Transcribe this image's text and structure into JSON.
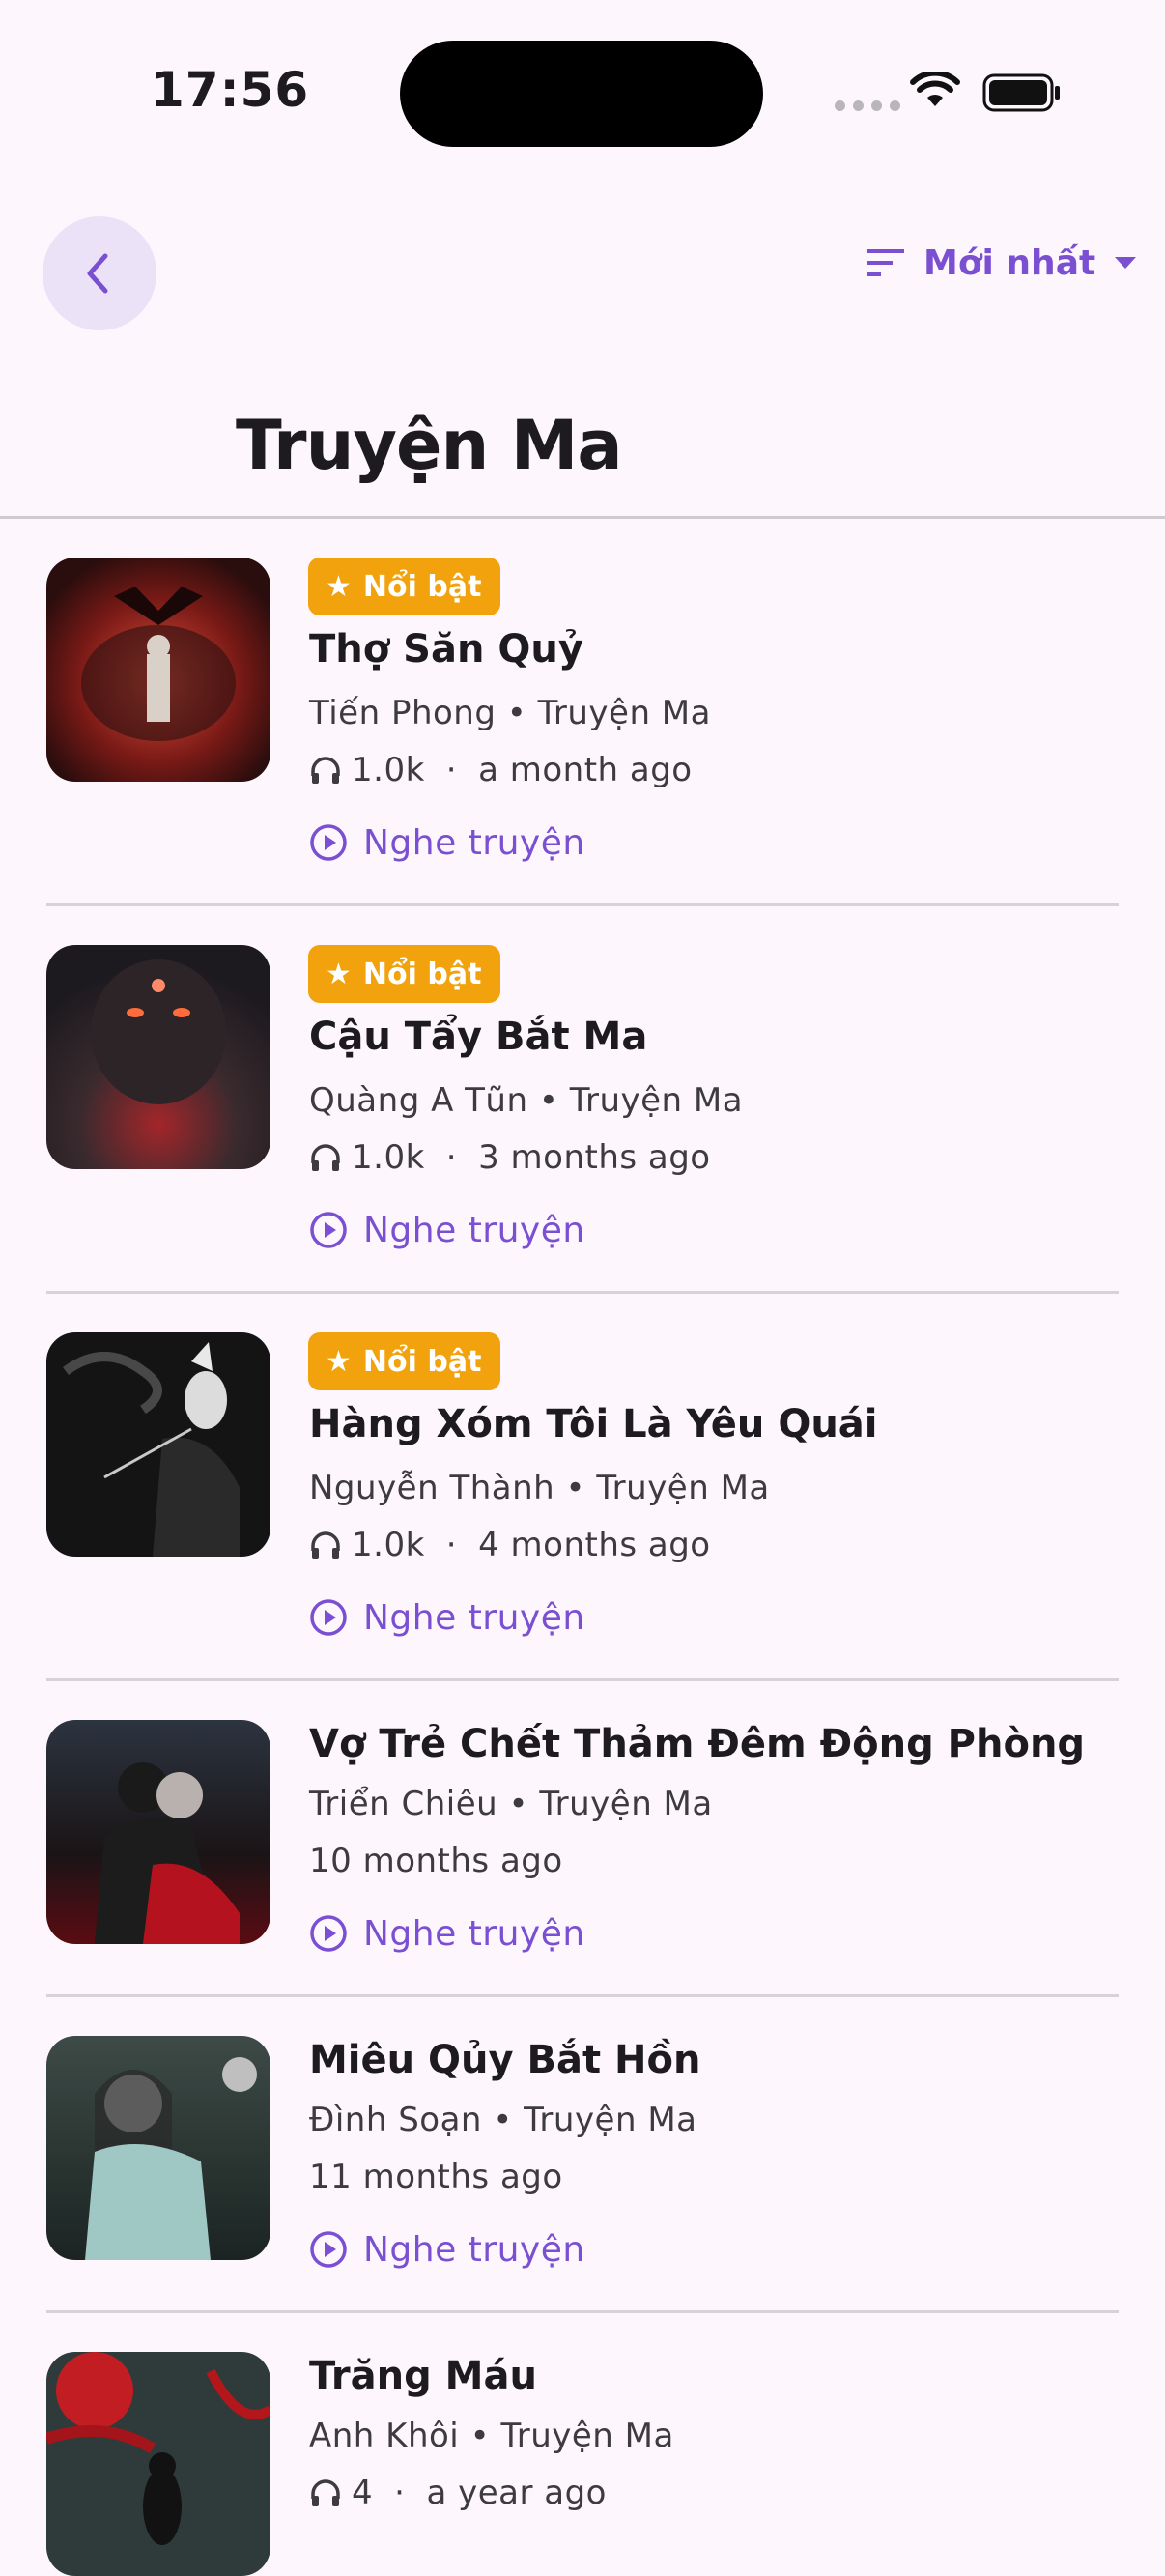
{
  "status_bar": {
    "time": "17:56"
  },
  "header": {
    "back_icon": "chevron-left-icon",
    "sort_label": "Mới nhất",
    "sort_icon": "sort-lines-icon",
    "dropdown_icon": "caret-down-icon",
    "title": "Truyện Ma"
  },
  "colors": {
    "accent": "#7a4fd2",
    "badge": "#f2a20c",
    "background": "#fdf7fd"
  },
  "stories": [
    {
      "featured": true,
      "badge": "Nổi bật",
      "title": "Thợ Săn Quỷ",
      "author": "Tiến Phong",
      "category": "Truyện Ma",
      "listens": "1.0k",
      "time_ago": "a month ago",
      "action": "Nghe truyện"
    },
    {
      "featured": true,
      "badge": "Nổi bật",
      "title": "Cậu Tẩy Bắt Ma",
      "author": "Quàng A Tũn",
      "category": "Truyện Ma",
      "listens": "1.0k",
      "time_ago": "3 months ago",
      "action": "Nghe truyện"
    },
    {
      "featured": true,
      "badge": "Nổi bật",
      "title": "Hàng Xóm Tôi Là Yêu Quái",
      "author": "Nguyễn Thành",
      "category": "Truyện Ma",
      "listens": "1.0k",
      "time_ago": "4 months ago",
      "action": "Nghe truyện"
    },
    {
      "featured": false,
      "title": "Vợ Trẻ Chết Thảm Đêm Động Phòng",
      "author": "Triển Chiêu",
      "category": "Truyện Ma",
      "time_ago": "10 months ago",
      "action": "Nghe truyện"
    },
    {
      "featured": false,
      "title": "Miêu Qủy Bắt Hồn",
      "author": "Đình Soạn",
      "category": "Truyện Ma",
      "time_ago": "11 months ago",
      "action": "Nghe truyện"
    },
    {
      "featured": false,
      "title": "Trăng Máu",
      "author": "Anh Khôi",
      "category": "Truyện Ma",
      "listens": "4",
      "time_ago": "a year ago",
      "action": "Nghe truyện"
    }
  ]
}
